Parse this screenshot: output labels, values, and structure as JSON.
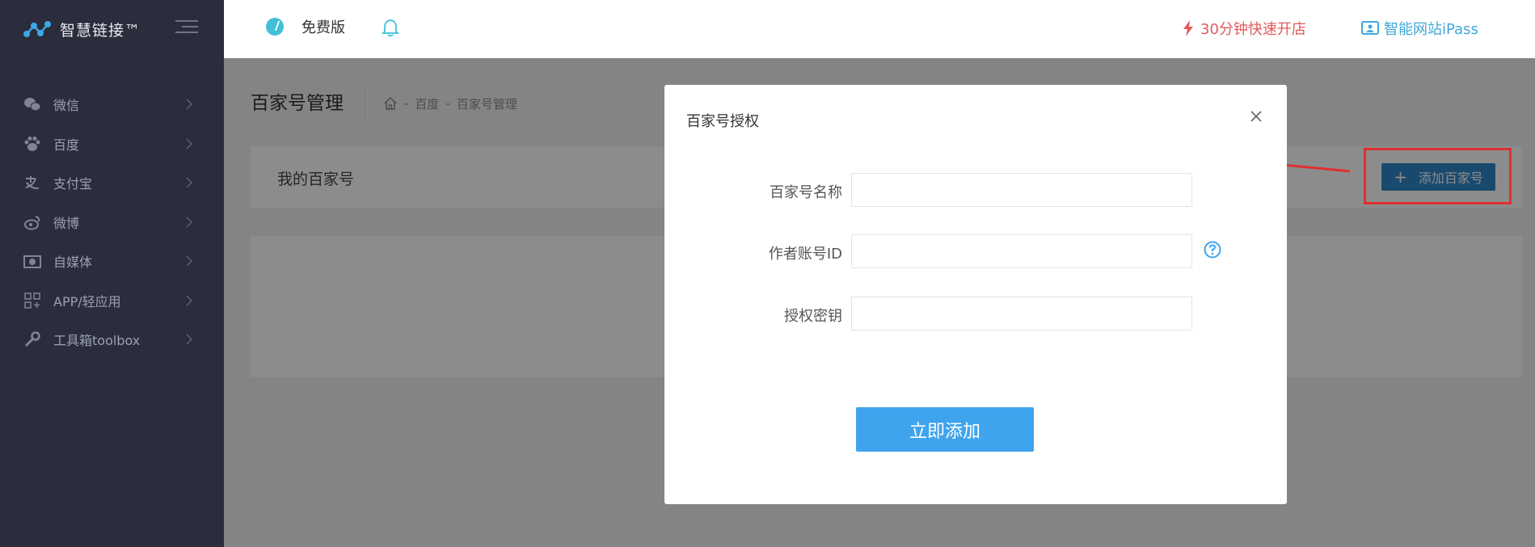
{
  "brand": {
    "name": "智慧链接™"
  },
  "sidebar": {
    "items": [
      {
        "label": "微信",
        "icon": "wechat-icon"
      },
      {
        "label": "百度",
        "icon": "paw-icon"
      },
      {
        "label": "支付宝",
        "icon": "alipay-icon"
      },
      {
        "label": "微博",
        "icon": "weibo-icon"
      },
      {
        "label": "自媒体",
        "icon": "camera-icon"
      },
      {
        "label": "APP/轻应用",
        "icon": "app-grid-icon"
      },
      {
        "label": "工具箱toolbox",
        "icon": "wrench-icon"
      }
    ]
  },
  "topbar": {
    "plan_label": "免费版",
    "promo_label": "30分钟快速开店",
    "ipass_label": "智能网站iPass"
  },
  "page": {
    "title": "百家号管理",
    "breadcrumb": [
      "百度",
      "百家号管理"
    ],
    "panel_title": "我的百家号",
    "add_button": "添加百家号"
  },
  "modal": {
    "title": "百家号授权",
    "fields": [
      {
        "label": "百家号名称",
        "value": "",
        "placeholder": ""
      },
      {
        "label": "作者账号ID",
        "value": "",
        "placeholder": ""
      },
      {
        "label": "授权密钥",
        "value": "",
        "placeholder": ""
      }
    ],
    "submit_label": "立即添加"
  },
  "colors": {
    "sidebar_bg": "#2b2d3c",
    "accent_blue": "#3fa4ee",
    "promo_red": "#e15b5b",
    "annotation_red": "#e03030"
  }
}
